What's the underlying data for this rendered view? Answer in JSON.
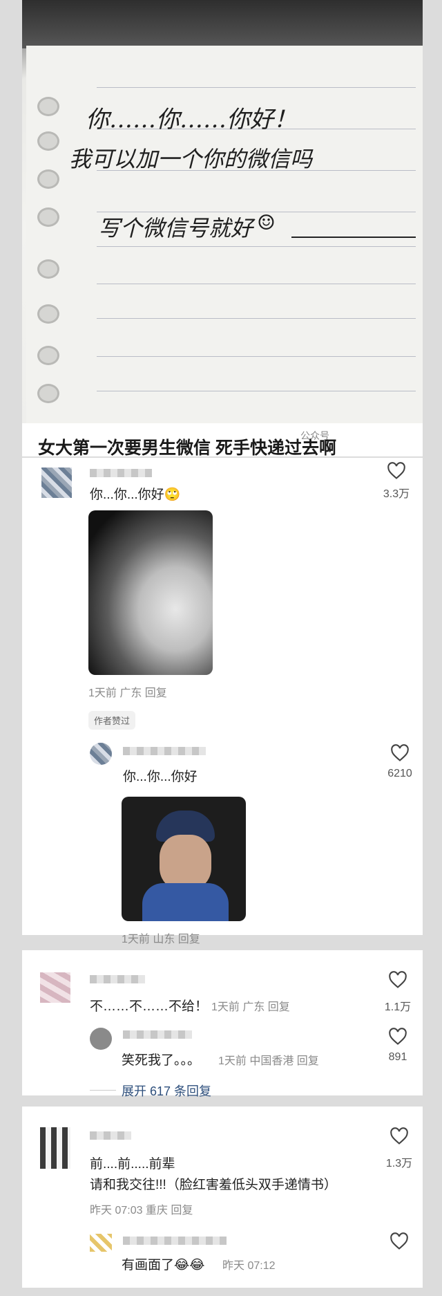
{
  "post": {
    "note_lines": [
      "你……你……你好！",
      "我可以加一个你的微信吗",
      "写个微信号就好"
    ],
    "caption": "女大第一次要男生微信 死手快递过去啊",
    "watermark": "公众号"
  },
  "comments": [
    {
      "text": "你...你...你好🙄",
      "likes": "3.3万",
      "meta": "1天前 广东 回复",
      "badge": "作者赞过",
      "reply": {
        "text": "你...你...你好",
        "likes": "6210",
        "meta": "1天前 山东 回复"
      }
    },
    {
      "text": "不……不……不给！",
      "meta": "1天前 广东 回复",
      "likes": "1.1万",
      "reply": {
        "text": "笑死我了。。。",
        "meta": "1天前 中国香港 回复",
        "likes": "891"
      },
      "expand": "展开 617 条回复"
    },
    {
      "line1": "前....前.....前辈",
      "line2": "请和我交往!!!（脸红害羞低头双手递情书）",
      "likes": "1.3万",
      "meta": "昨天 07:03 重庆 回复",
      "reply": {
        "text": "有画面了😂😂",
        "meta": "昨天 07:12"
      }
    }
  ]
}
